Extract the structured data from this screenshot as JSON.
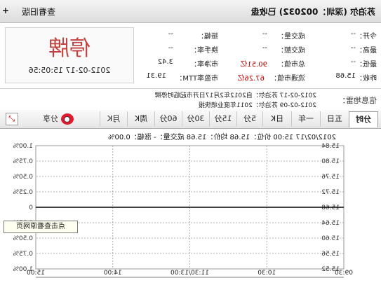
{
  "window": {
    "title": "苏泊尔 (深圳：002032) 已收盘",
    "back_label": "查看旧版",
    "plus_label": "+"
  },
  "quote": {
    "rows": [
      {
        "l1": "今开：",
        "v1": "--",
        "l2": "成交量：",
        "v2": "--",
        "l3": "振幅：",
        "v3": "--"
      },
      {
        "l1": "最高：",
        "v1": "--",
        "l2": "成交额：",
        "v2": "--",
        "l3": "换手率：",
        "v3": "--"
      },
      {
        "l1": "最低：",
        "v1": "--",
        "l2": "总市值：",
        "v2": "90.51亿",
        "l3": "市净率：",
        "v3": "3.42"
      },
      {
        "l1": "昨收：",
        "v1": "15.68",
        "l2": "流通市值：",
        "v2": "67.26亿",
        "l3": "市盈率TTM：",
        "v3": "19.31"
      }
    ],
    "halt_label": "停牌",
    "halt_time": "2012-02-17 15:05:56"
  },
  "news": {
    "title": "信息地雷：",
    "lines": [
      "2012-02-17  苏泊尔：自2012年2月17日开市起临时停牌",
      "2012-02-09  苏泊尔：2011年度业绩快报"
    ]
  },
  "tabs": {
    "items": [
      "分时",
      "五日",
      "一年",
      "日K",
      "5分",
      "15分",
      "30分",
      "60分",
      "周K",
      "月K"
    ],
    "active": 0,
    "share_label": "分享",
    "expand_icon": "expand-icon"
  },
  "chart_header": "2012/02/17 15:00  价位：15.68  均价：15.68  成交量：-  涨幅：0.00%",
  "tooltip": "点击查看原网页",
  "chart_data": {
    "type": "line",
    "y_left_ticks": [
      "1.00%",
      "0.75%",
      "0.50%",
      "0.25%",
      "0",
      "0.25%",
      "0.50%",
      "0.75%",
      "1.00%"
    ],
    "y_right_ticks": [
      "15.84",
      "15.80",
      "15.76",
      "15.72",
      "15.68",
      "15.64",
      "15.60",
      "15.56",
      "15.52"
    ],
    "x_ticks": [
      "09:30",
      "10:30",
      "11:30/13:00",
      "14:00",
      "15:00"
    ],
    "ylim": [
      15.52,
      15.84
    ],
    "series": [
      {
        "values": [
          15.68,
          15.68,
          15.68,
          15.68,
          15.68
        ]
      }
    ],
    "grid": true
  },
  "colors": {
    "price_line": "#000000",
    "grid": "#9a9a9a",
    "halt": "#c04040"
  }
}
